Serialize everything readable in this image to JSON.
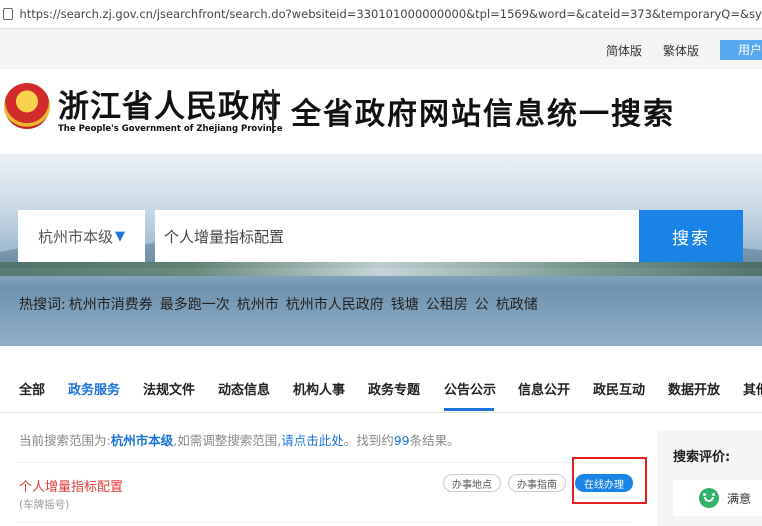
{
  "browser": {
    "url": "https://search.zj.gov.cn/jsearchfront/search.do?websiteid=330101000000000&tpl=1569&word=&cateid=373&temporaryQ=&synonyms=&checkError="
  },
  "langbar": {
    "simplified": "简体版",
    "traditional": "繁体版",
    "user": "用户"
  },
  "header": {
    "site_name_cn": "浙江省人民政府",
    "site_name_en": "The People's Government of Zhejiang Province",
    "slogan": "全省政府网站信息统一搜索"
  },
  "search": {
    "region": "杭州市本级",
    "region_arrow": "▼",
    "query": "个人增量指标配置",
    "button": "搜索"
  },
  "hot": {
    "label": "热搜词:",
    "terms": [
      "杭州市消费券",
      "最多跑一次",
      "杭州市",
      "杭州市人民政府",
      "钱塘",
      "公租房",
      "公",
      "杭政储"
    ]
  },
  "nav": {
    "tabs": [
      "全部",
      "政务服务",
      "法规文件",
      "动态信息",
      "机构人事",
      "政务专题",
      "公告公示",
      "信息公开",
      "政民互动",
      "数据开放",
      "其他"
    ]
  },
  "scope": {
    "prefix": "当前搜索范围为:",
    "region": "杭州市本级",
    "mid": ",如需调整搜索范围,",
    "link": "请点击此处",
    "found_prefix": "。找到约",
    "count": "99",
    "found_suffix": "条结果。"
  },
  "result": {
    "title": "个人增量指标配置",
    "subtitle": "(车牌摇号)",
    "buttons": [
      "办事地点",
      "办事指南",
      "在线办理"
    ]
  },
  "sidebar": {
    "title": "搜索评价:",
    "satisfied": "满意"
  }
}
